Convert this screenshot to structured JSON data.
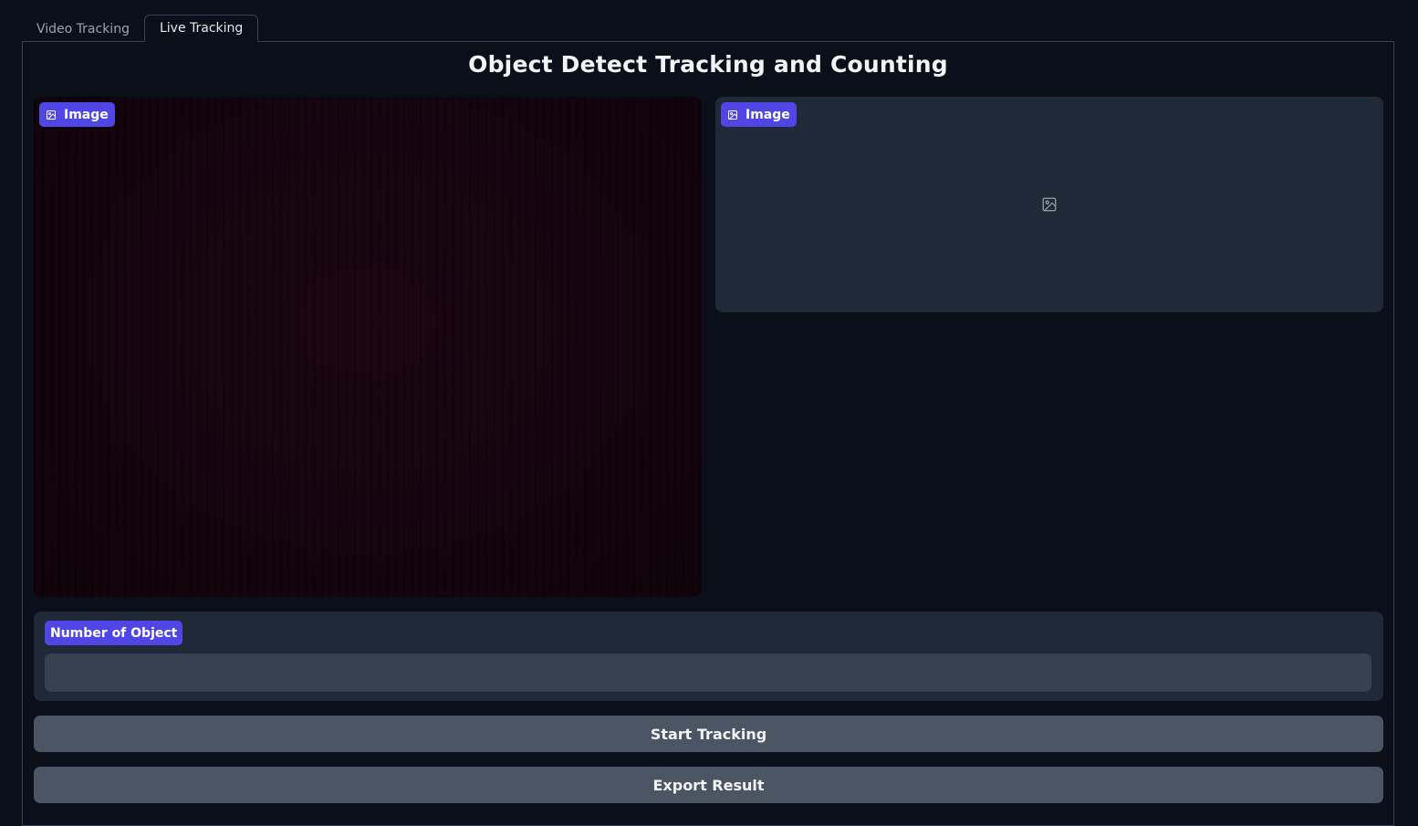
{
  "tabs": [
    {
      "label": "Video Tracking",
      "active": false
    },
    {
      "label": "Live Tracking",
      "active": true
    }
  ],
  "title": "Object Detect Tracking and Counting",
  "input_image": {
    "label": "Image",
    "icon": "image-icon"
  },
  "output_image": {
    "label": "Image",
    "icon": "image-icon",
    "placeholder_icon": "image-placeholder-icon"
  },
  "count": {
    "label": "Number of Object",
    "value": ""
  },
  "buttons": {
    "start": "Start Tracking",
    "export": "Export Result"
  },
  "colors": {
    "background": "#0b0f19",
    "panel_block": "#1f2937",
    "badge": "#4f46e5",
    "button": "#4b5563",
    "input": "#374151"
  }
}
